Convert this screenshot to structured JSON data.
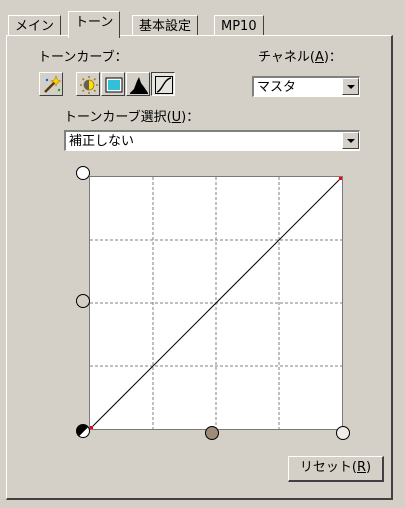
{
  "tabs": [
    {
      "label": "メイン",
      "active": false
    },
    {
      "label": "トーン",
      "active": true
    },
    {
      "label": "基本設定",
      "active": false
    },
    {
      "label": "MP10",
      "active": false
    }
  ],
  "tone_curve": {
    "label": "トーンカーブ：",
    "selection_label_prefix": "トーンカーブ選択(",
    "selection_label_key": "U",
    "selection_label_suffix": ")：",
    "selection_value": "補正しない"
  },
  "channel": {
    "label_prefix": "チャネル(",
    "label_key": "A",
    "label_suffix": ")：",
    "value": "マスタ"
  },
  "toolbar_icons": [
    {
      "name": "magic-wand-icon"
    },
    {
      "name": "brightness-icon"
    },
    {
      "name": "image-icon"
    },
    {
      "name": "histogram-icon"
    },
    {
      "name": "curve-icon",
      "pressed": true
    }
  ],
  "reset_button": {
    "label_prefix": "リセット(",
    "label_key": "R",
    "label_suffix": ")"
  },
  "colors": {
    "face": "#d4d0c8",
    "handle_output_top": "#ffffff",
    "handle_output_mid": "#d4d0c8",
    "handle_input_mid": "#a08a78",
    "handle_input_right": "#f0ede6",
    "curve_endpoint": "#ff0000"
  }
}
